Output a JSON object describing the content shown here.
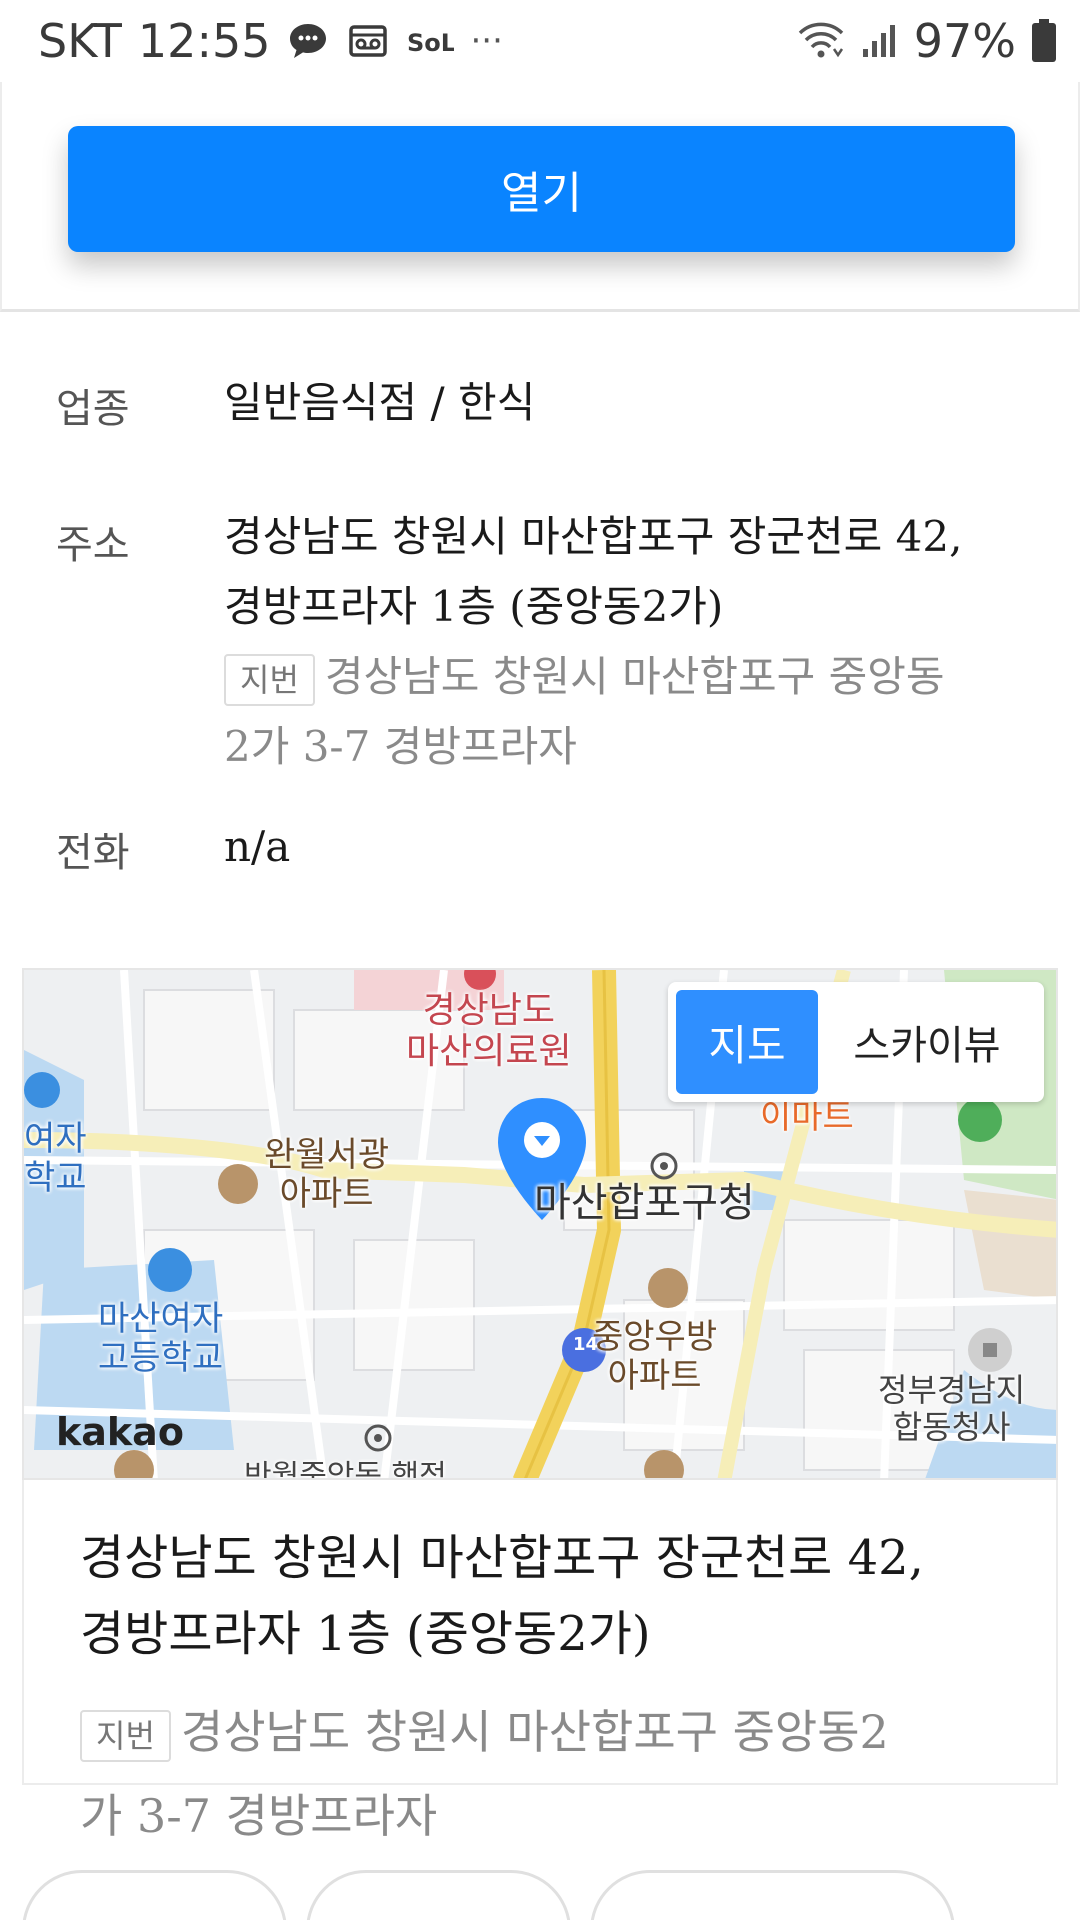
{
  "status_bar": {
    "carrier": "SKT",
    "time": "12:55",
    "sol_label": "SOL",
    "more": "···",
    "battery": "97%"
  },
  "top": {
    "open_label": "열기"
  },
  "info": {
    "category_label": "업종",
    "category_value": "일반음식점 / 한식",
    "address_label": "주소",
    "address_line1": "경상남도 창원시 마산합포구 장군천로 42,",
    "address_line2": "경방프라자 1층 (중앙동2가)",
    "jibun_tag": "지번",
    "jibun_line1": "경상남도 창원시 마산합포구 중앙동",
    "jibun_line2": "2가 3-7 경방프라자",
    "phone_label": "전화",
    "phone_value": "n/a"
  },
  "map": {
    "toggle_map": "지도",
    "toggle_sky": "스카이뷰",
    "logo": "kakao",
    "labels": {
      "medical_1": "경상남도",
      "medical_2": "마산의료원",
      "emart": "이마트",
      "womens_1": "여자",
      "womens_2": "학교",
      "wanwol_1": "완월서광",
      "wanwol_2": "아파트",
      "gucheong": "마산합포구청",
      "girls_high_1": "마산여자",
      "girls_high_2": "고등학교",
      "jungang_1": "중앙우방",
      "jungang_2": "아파트",
      "gov_1": "정부경남지",
      "gov_2": "합동청사",
      "route": "14",
      "bottom_partial": "반월중앙동 행정"
    },
    "colors": {
      "road_main": "#f2d25b",
      "water": "#bcd9f2",
      "park": "#cfe8c4",
      "hospital": "#d9505a",
      "pin": "#2f8fff"
    }
  },
  "address_card": {
    "line1": "경상남도 창원시 마산합포구 장군천로 42,",
    "line2": "경방프라자 1층 (중앙동2가)",
    "jibun_tag": "지번",
    "jibun_line1": "경상남도 창원시 마산합포구 중앙동2",
    "jibun_line2": "가 3-7 경방프라자"
  }
}
